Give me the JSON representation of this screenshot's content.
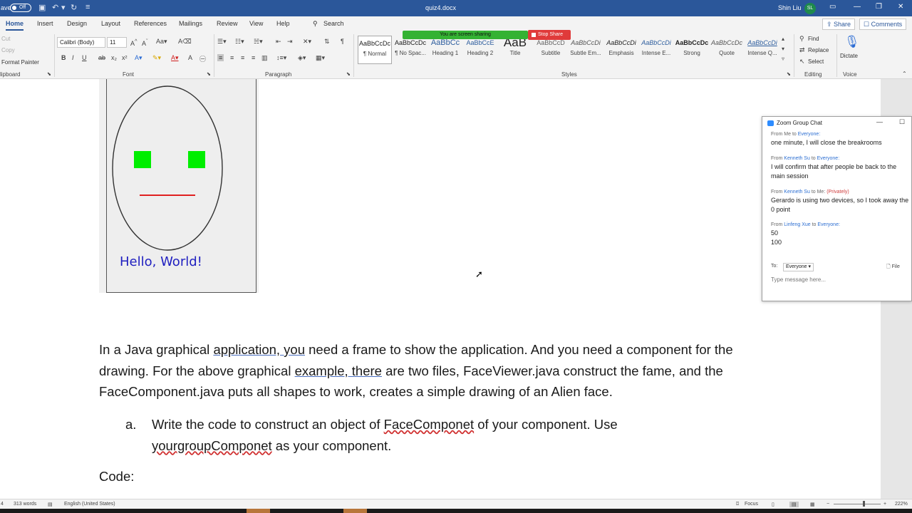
{
  "titlebar": {
    "autosave_label": "ave",
    "autosave_state": "Off",
    "doc_name": "quiz4.docx",
    "user_name": "Shin Liu",
    "user_initials": "SL"
  },
  "tabs": [
    "Home",
    "Insert",
    "Design",
    "Layout",
    "References",
    "Mailings",
    "Review",
    "View",
    "Help"
  ],
  "search_label": "Search",
  "share_label": "Share",
  "comments_label": "Comments",
  "ribbon": {
    "clipboard": {
      "cut": "Cut",
      "copy": "Copy",
      "format_painter": "Format Painter",
      "label": "lipboard"
    },
    "font": {
      "name": "Calibri (Body)",
      "size": "11",
      "label": "Font"
    },
    "paragraph": {
      "label": "Paragraph"
    },
    "styles": {
      "label": "Styles",
      "items": [
        {
          "preview": "AaBbCcDc",
          "name": "¶ Normal"
        },
        {
          "preview": "AaBbCcDc",
          "name": "¶ No Spac..."
        },
        {
          "preview": "AaBbCc",
          "name": "Heading 1"
        },
        {
          "preview": "AaBbCcE",
          "name": "Heading 2"
        },
        {
          "preview": "AaB",
          "name": "Title"
        },
        {
          "preview": "AaBbCcD",
          "name": "Subtitle"
        },
        {
          "preview": "AaBbCcDi",
          "name": "Subtle Em..."
        },
        {
          "preview": "AaBbCcDi",
          "name": "Emphasis"
        },
        {
          "preview": "AaBbCcDi",
          "name": "Intense E..."
        },
        {
          "preview": "AaBbCcDc",
          "name": "Strong"
        },
        {
          "preview": "AaBbCcDc",
          "name": "Quote"
        },
        {
          "preview": "AaBbCcDi",
          "name": "Intense Q..."
        }
      ]
    },
    "editing": {
      "find": "Find",
      "replace": "Replace",
      "select": "Select",
      "label": "Editing"
    },
    "voice": {
      "dictate": "Dictate",
      "label": "Voice"
    }
  },
  "screen_share": {
    "banner": "You are screen sharing",
    "stop": "Stop Share"
  },
  "figure": {
    "hello": "Hello, World!"
  },
  "document": {
    "para_parts": [
      "In a Java graphical ",
      "application,  you",
      " need a frame to show the application. And you need a component for the drawing.  For the above graphical ",
      "example,  there",
      " are two files, FaceViewer.java construct the fame, and the FaceComponent.java puts all shapes to work, creates a simple drawing of an Alien face."
    ],
    "list_marker": "a.",
    "list_parts": [
      "Write the code to construct an object of ",
      "FaceComponet",
      " of your component.  Use ",
      "yourgroupComponet",
      " as your component."
    ],
    "code_label": "Code:"
  },
  "chat": {
    "title": "Zoom Group Chat",
    "messages": [
      {
        "prefix": "From ",
        "sender": "Me",
        "mid": " to ",
        "recipient": "Everyone",
        "suffix": ":",
        "private": "",
        "body": "one minute, I will close the breakrooms"
      },
      {
        "prefix": "From ",
        "sender": "Kenneth Su",
        "mid": " to ",
        "recipient": "Everyone",
        "suffix": ":",
        "private": "",
        "body": "I will confirm that after people be back to the main session"
      },
      {
        "prefix": "From ",
        "sender": "Kenneth Su",
        "mid": " to Me: ",
        "recipient": "",
        "suffix": "",
        "private": "(Privately)",
        "body": "Gerardo is using two devices, so I took away the 0 point"
      },
      {
        "prefix": "From ",
        "sender": "Linfeng Xue",
        "mid": " to ",
        "recipient": "Everyone",
        "suffix": ":",
        "private": "",
        "body": "50\n100"
      }
    ],
    "to_label": "To:",
    "to_value": "Everyone",
    "file_label": "File",
    "input_placeholder": "Type message here..."
  },
  "statusbar": {
    "page": "4",
    "words": "313 words",
    "language": "English (United States)",
    "focus": "Focus",
    "zoom": "222%"
  },
  "colors": {
    "word_blue": "#2b579a",
    "share_green": "#34b233",
    "stop_red": "#e03a3a",
    "eye_green": "#00ee00",
    "mouth_red": "#e02020"
  }
}
